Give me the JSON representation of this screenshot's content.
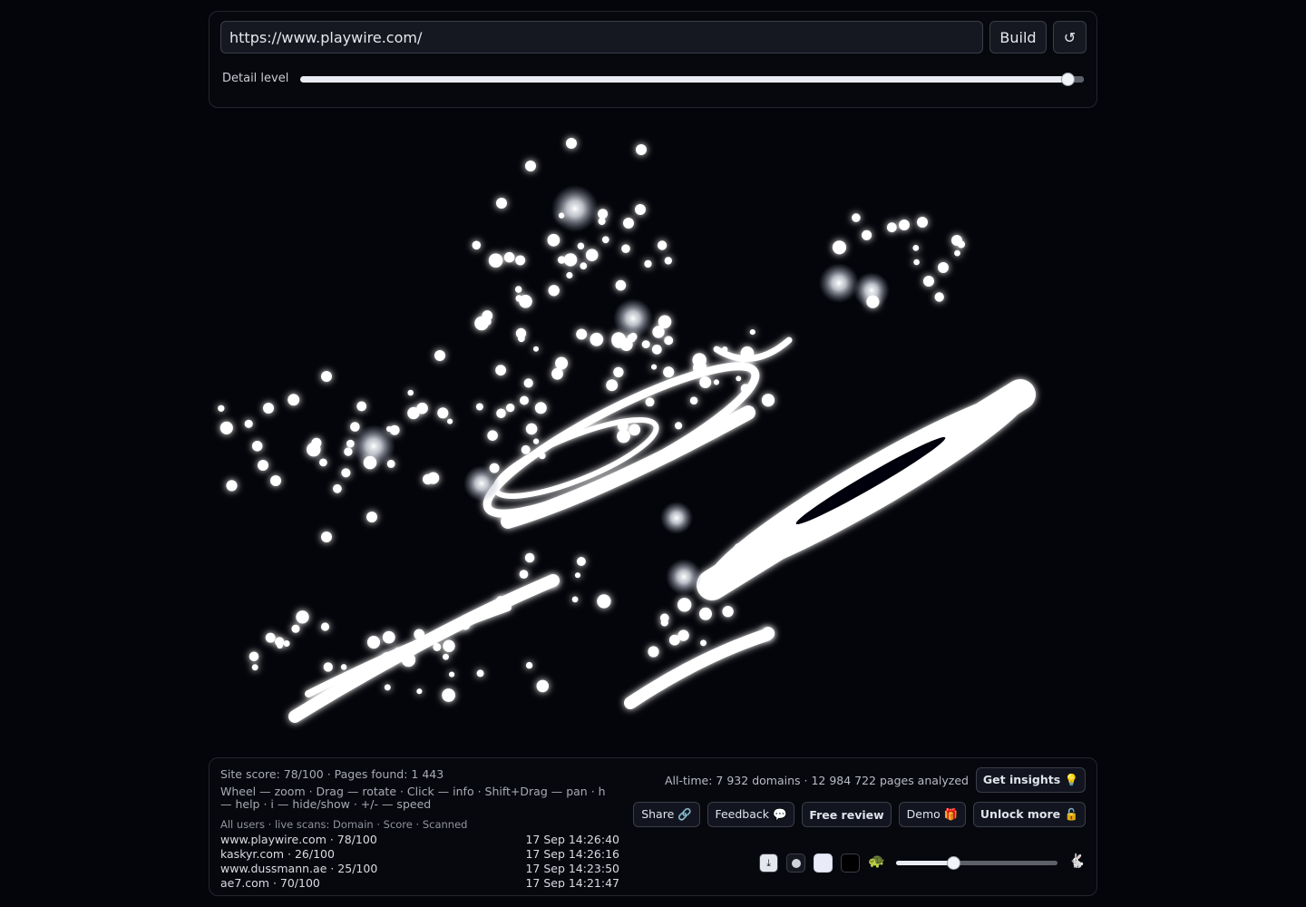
{
  "toolbar": {
    "url_value": "https://www.playwire.com/",
    "build_label": "Build",
    "reset_icon": "↺",
    "detail_label": "Detail level",
    "detail_level_fraction": 0.98
  },
  "stats": {
    "site": "Site score: 78/100 · Pages found: 1 443",
    "help": "Wheel — zoom · Drag — rotate · Click — info · Shift+Drag — pan · h — help · i — hide/show · +/- — speed",
    "scans_header": "All users · live scans: Domain · Score · Scanned",
    "alltime": "All-time: 7 932 domains · 12 984 722 pages analyzed"
  },
  "scans": [
    {
      "domain": "www.playwire.com · 78/100",
      "time": "17 Sep 14:26:40"
    },
    {
      "domain": "kaskyr.com · 26/100",
      "time": "17 Sep 14:26:16"
    },
    {
      "domain": "www.dussmann.ae · 25/100",
      "time": "17 Sep 14:23:50"
    },
    {
      "domain": "ae7.com · 70/100",
      "time": "17 Sep 14:21:47"
    }
  ],
  "actions": {
    "insights": "Get insights 💡",
    "share": "Share 🔗",
    "feedback": "Feedback 💬",
    "review": "Free review",
    "demo": "Demo 🎁",
    "unlock": "Unlock more 🔓"
  },
  "controls": {
    "download_icon": "⤓",
    "turtle_icon": "🐢",
    "rabbit_icon": "🐇",
    "speed_fraction": 0.36
  },
  "colors": {
    "background": "#04050a",
    "node": "#ffffff"
  }
}
